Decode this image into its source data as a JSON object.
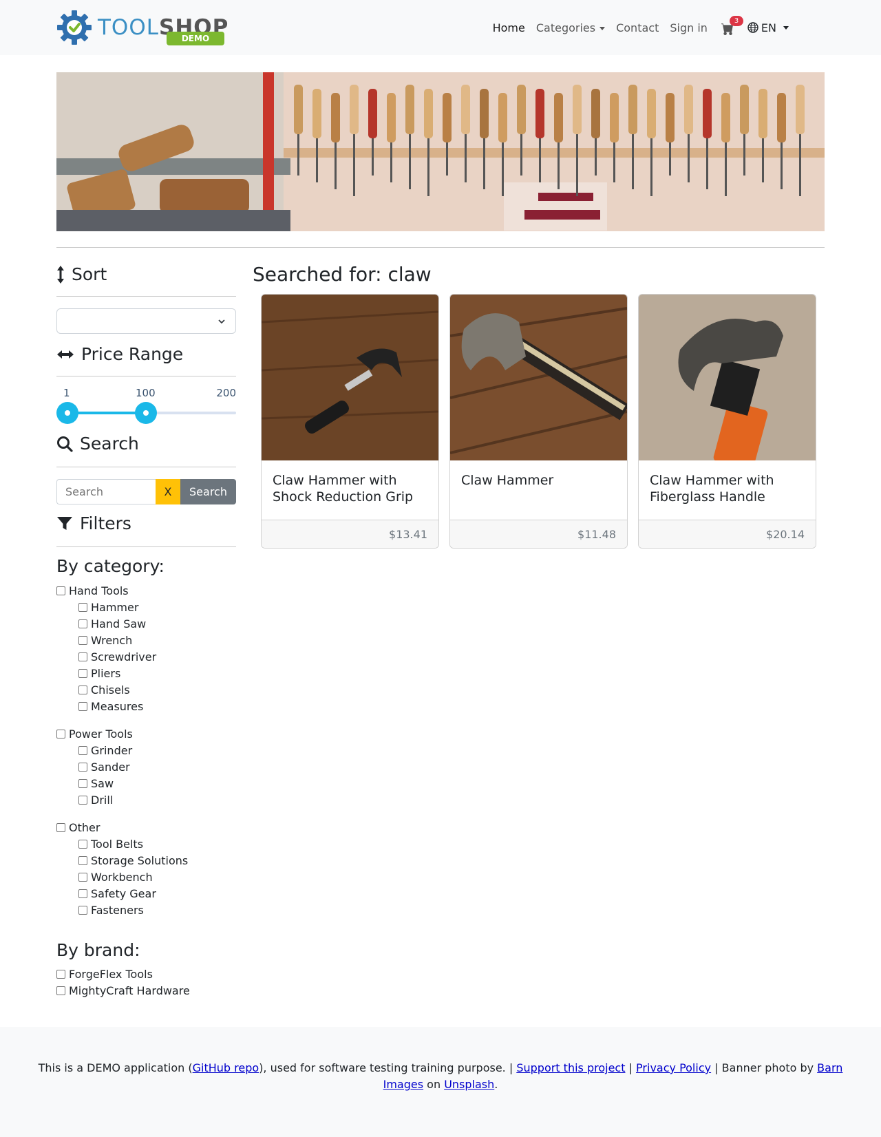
{
  "logo": {
    "tool": "TOOL",
    "shop": "SHOP",
    "badge": "DEMO"
  },
  "nav": {
    "home": "Home",
    "categories": "Categories",
    "contact": "Contact",
    "sign_in": "Sign in",
    "cart_count": "3",
    "language": "EN"
  },
  "sidebar": {
    "sort_heading": "Sort",
    "sort_value": "",
    "price_heading": "Price Range",
    "price_min": "1",
    "price_max": "200",
    "price_selected_low": "1",
    "price_selected_high": "100",
    "search_heading": "Search",
    "search_placeholder": "Search",
    "search_clear": "X",
    "search_button": "Search",
    "filters_heading": "Filters",
    "by_category": "By category:",
    "categories": [
      {
        "label": "Hand Tools",
        "children": [
          "Hammer",
          "Hand Saw",
          "Wrench",
          "Screwdriver",
          "Pliers",
          "Chisels",
          "Measures"
        ]
      },
      {
        "label": "Power Tools",
        "children": [
          "Grinder",
          "Sander",
          "Saw",
          "Drill"
        ]
      },
      {
        "label": "Other",
        "children": [
          "Tool Belts",
          "Storage Solutions",
          "Workbench",
          "Safety Gear",
          "Fasteners"
        ]
      }
    ],
    "by_brand": "By brand:",
    "brands": [
      "ForgeFlex Tools",
      "MightyCraft Hardware"
    ]
  },
  "main": {
    "search_title": "Searched for: claw",
    "products": [
      {
        "name": "Claw Hammer with Shock Reduction Grip",
        "price": "$13.41"
      },
      {
        "name": "Claw Hammer",
        "price": "$11.48"
      },
      {
        "name": "Claw Hammer with Fiberglass Handle",
        "price": "$20.14"
      }
    ]
  },
  "footer": {
    "t1": "This is a DEMO application (",
    "github": "GitHub repo",
    "t2": "), used for software testing training purpose. | ",
    "support": "Support this project",
    "t3": " | ",
    "privacy": "Privacy Policy",
    "t4": " | Banner photo by ",
    "barn": "Barn Images",
    "t5": " on ",
    "unsplash": "Unsplash",
    "t6": "."
  },
  "colors": {
    "accent": "#1ab8e8",
    "warning": "#ffc107",
    "secondary": "#6c757d",
    "badge": "#dc3545",
    "link": "#0000cc"
  }
}
